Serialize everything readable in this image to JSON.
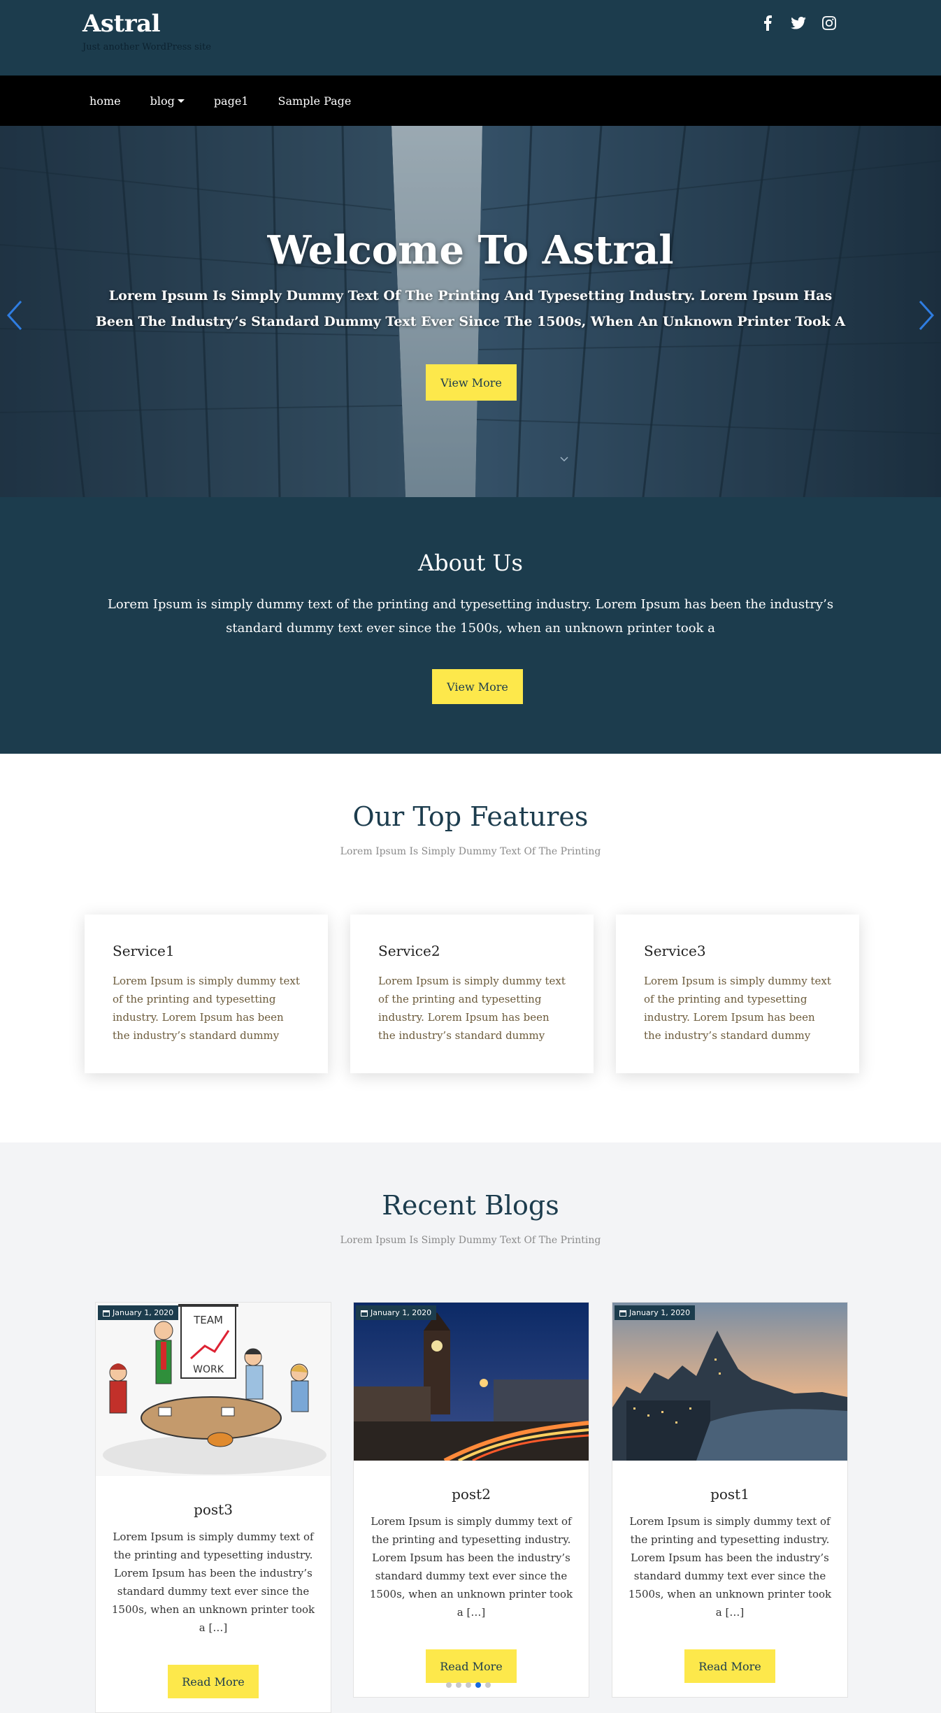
{
  "header": {
    "site_title": "Astral",
    "tagline": "Just another WordPress site",
    "social_icons": [
      "facebook-icon",
      "twitter-icon",
      "instagram-icon"
    ]
  },
  "nav": {
    "items": [
      {
        "label": "home"
      },
      {
        "label": "blog",
        "has_dropdown": true
      },
      {
        "label": "page1"
      },
      {
        "label": "Sample Page"
      }
    ]
  },
  "hero": {
    "title": "Welcome To Astral",
    "text": "Lorem Ipsum Is Simply Dummy Text Of The Printing And Typesetting Industry. Lorem Ipsum Has Been The Industry’s Standard Dummy Text Ever Since The 1500s, When An Unknown Printer Took A",
    "button": "View More",
    "prev_icon": "chevron-left-icon",
    "next_icon": "chevron-right-icon"
  },
  "about": {
    "title": "About Us",
    "text": "Lorem Ipsum is simply dummy text of the printing and typesetting industry. Lorem Ipsum has been the industry’s standard dummy text ever since the 1500s, when an unknown printer took a",
    "button": "View More"
  },
  "features": {
    "title": "Our Top Features",
    "subtitle": "Lorem Ipsum Is Simply Dummy Text Of The Printing",
    "items": [
      {
        "name": "Service1",
        "desc": "Lorem Ipsum is simply dummy text of the printing and typesetting industry. Lorem Ipsum has been the industry’s standard dummy"
      },
      {
        "name": "Service2",
        "desc": "Lorem Ipsum is simply dummy text of the printing and typesetting industry. Lorem Ipsum has been the industry’s standard dummy"
      },
      {
        "name": "Service3",
        "desc": "Lorem Ipsum is simply dummy text of the printing and typesetting industry. Lorem Ipsum has been the industry’s standard dummy"
      }
    ]
  },
  "blogs": {
    "title": "Recent Blogs",
    "subtitle": "Lorem Ipsum Is Simply Dummy Text Of The Printing",
    "posts": [
      {
        "date": "January 1, 2020",
        "title": "post3",
        "excerpt": "Lorem Ipsum is simply dummy text of the printing and typesetting industry. Lorem Ipsum has been the industry’s standard dummy text ever since the 1500s, when an unknown printer took a […]",
        "button": "Read More"
      },
      {
        "date": "January 1, 2020",
        "title": "post2",
        "excerpt": "Lorem Ipsum is simply dummy text of the printing and typesetting industry. Lorem Ipsum has been the industry’s standard dummy text ever since the 1500s, when an unknown printer took a […]",
        "button": "Read More"
      },
      {
        "date": "January 1, 2020",
        "title": "post1",
        "excerpt": "Lorem Ipsum is simply dummy text of the printing and typesetting industry. Lorem Ipsum has been the industry’s standard dummy text ever since the 1500s, when an unknown printer took a […]",
        "button": "Read More"
      }
    ],
    "carousel_dots": 5,
    "active_dot": 4
  },
  "colors": {
    "primary": "#1c3c4d",
    "accent": "#fde84b",
    "nav_bg": "#000000",
    "dot_active": "#1769e0"
  }
}
